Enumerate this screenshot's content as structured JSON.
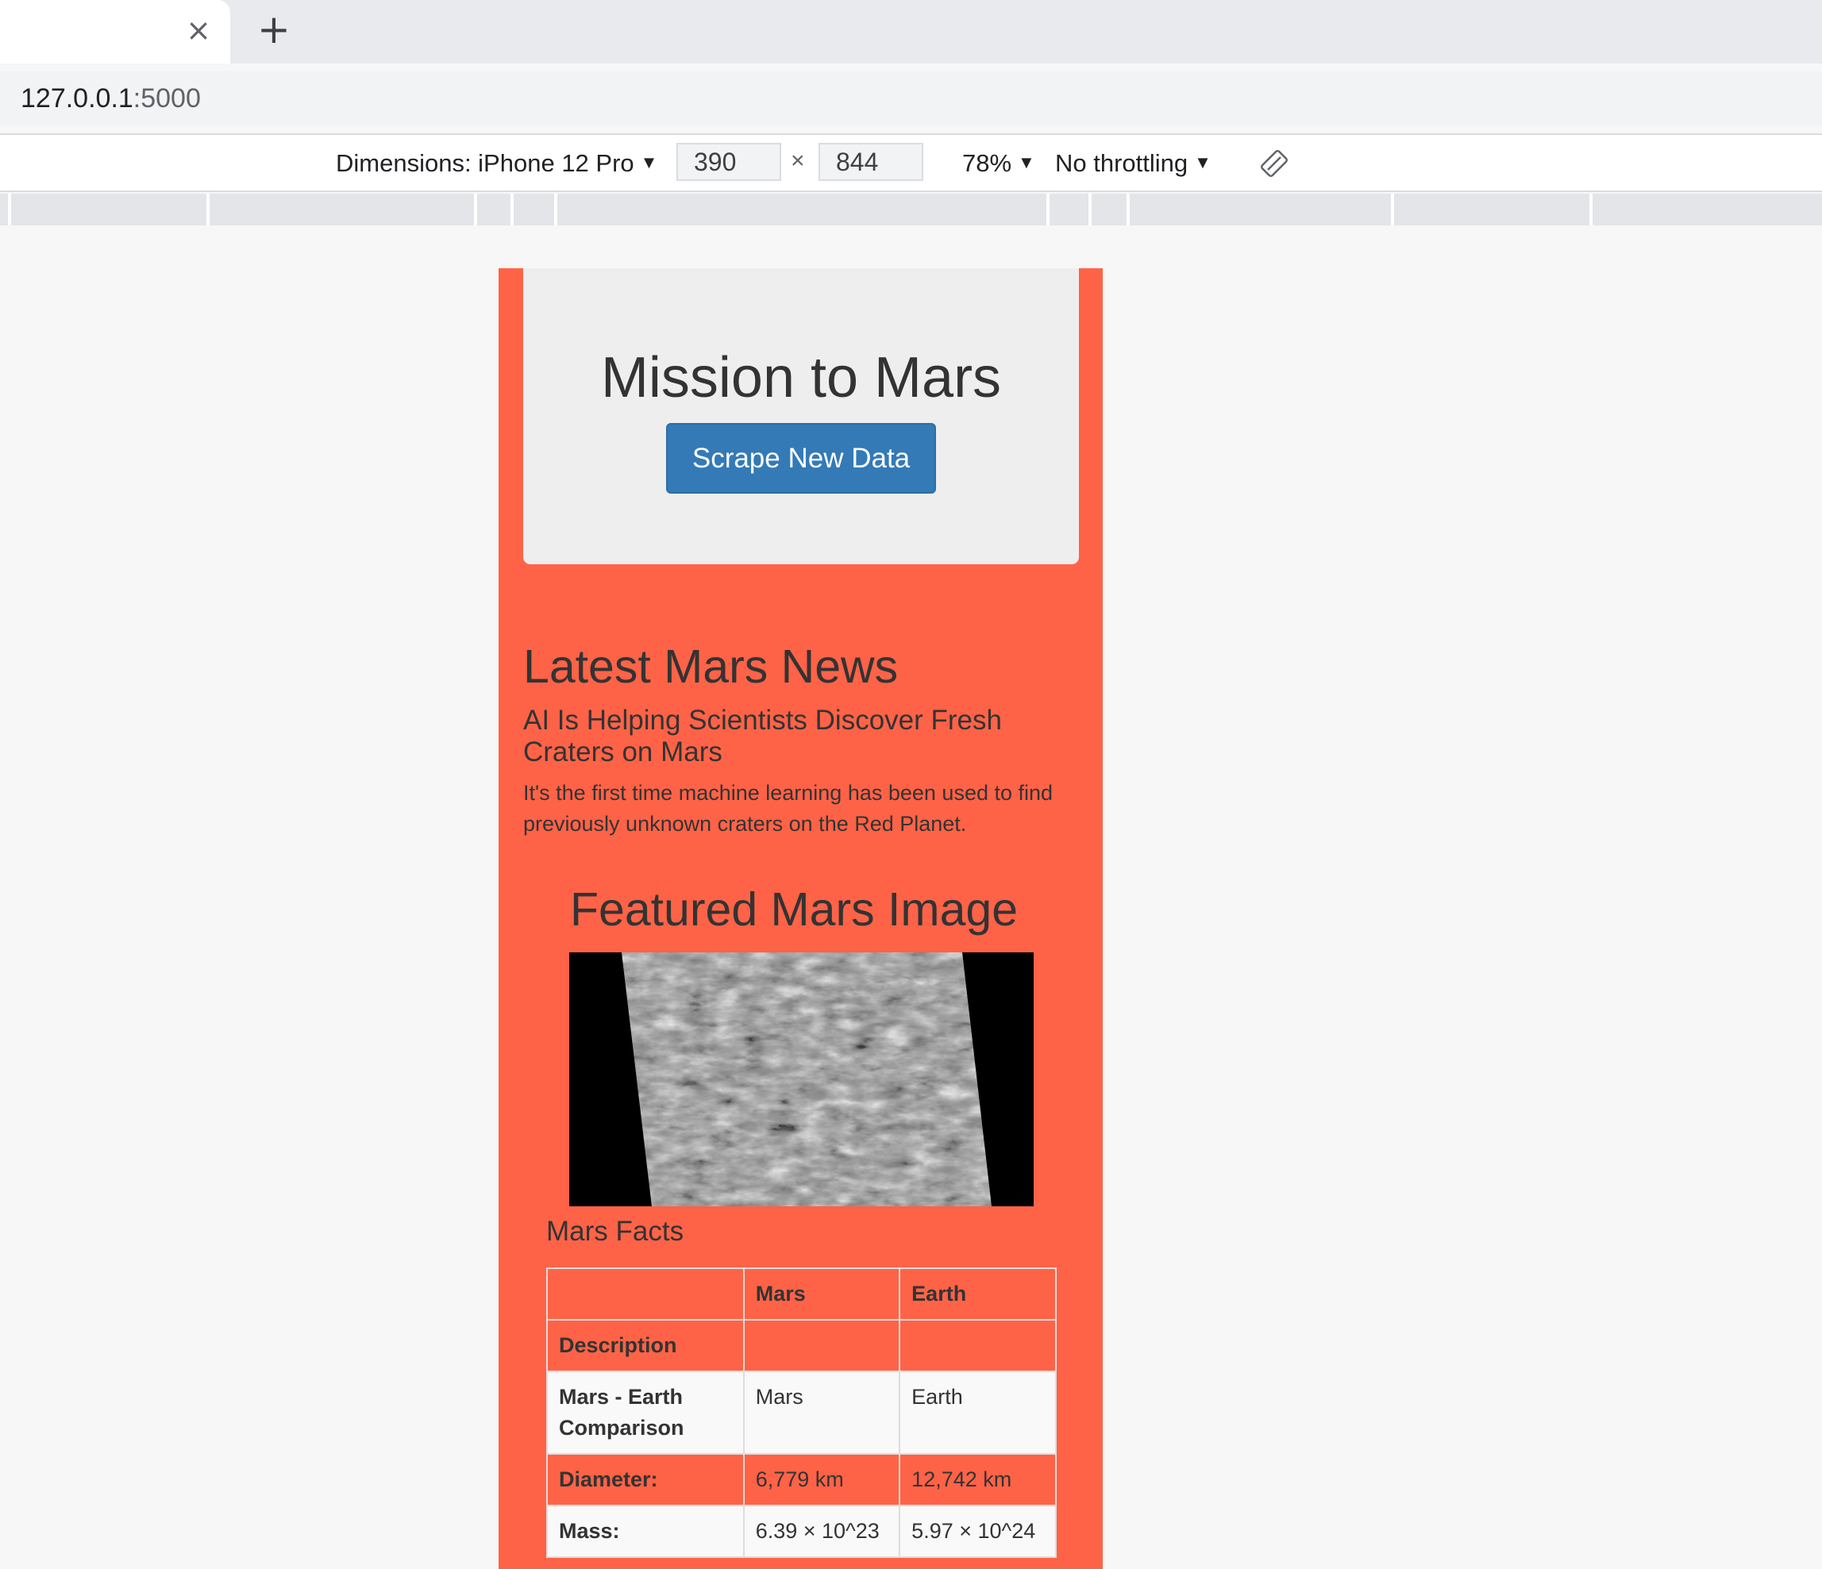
{
  "browser": {
    "tab_close": "×",
    "new_tab": "+",
    "url_host": "127.0.0.1",
    "url_port": ":5000"
  },
  "devtools": {
    "dimensions_label": "Dimensions: iPhone 12 Pro",
    "width": "390",
    "height": "844",
    "times": "×",
    "zoom": "78%",
    "throttling": "No throttling",
    "caret": "▼"
  },
  "page": {
    "title": "Mission to Mars",
    "scrape_button": "Scrape New Data",
    "news": {
      "heading": "Latest Mars News",
      "title": "AI Is Helping Scientists Discover Fresh Craters on Mars",
      "paragraph": "It's the first time machine learning has been used to find previously unknown craters on the Red Planet."
    },
    "featured": {
      "heading": "Featured Mars Image"
    },
    "facts": {
      "heading": "Mars Facts",
      "columns": [
        "",
        "Mars",
        "Earth"
      ],
      "rows": [
        {
          "label": "Description",
          "mars": "",
          "earth": ""
        },
        {
          "label": "Mars - Earth Comparison",
          "mars": "Mars",
          "earth": "Earth"
        },
        {
          "label": "Diameter:",
          "mars": "6,779 km",
          "earth": "12,742 km"
        },
        {
          "label": "Mass:",
          "mars": "6.39 × 10^23",
          "earth": "5.97 × 10^24"
        }
      ]
    }
  },
  "colors": {
    "page_background": "#ff6347",
    "button_primary": "#337ab7",
    "jumbotron": "#eeeeee"
  }
}
